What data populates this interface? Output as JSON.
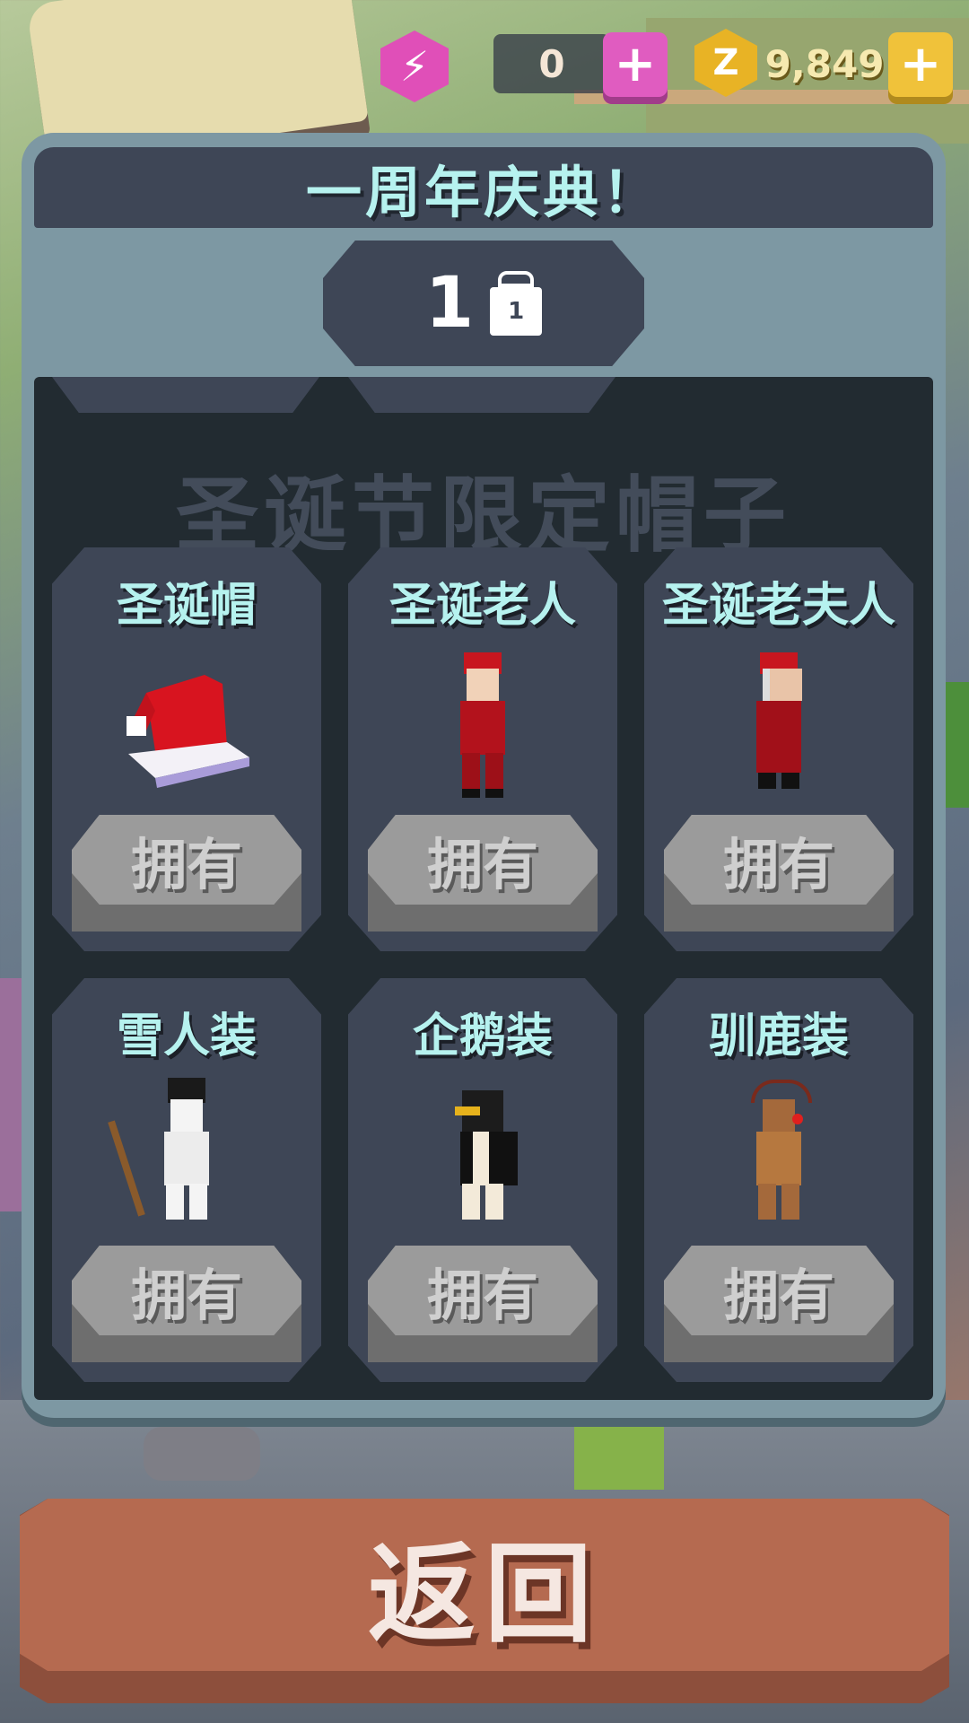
{
  "topbar": {
    "gem_icon": "lightning-gem-icon",
    "gem_count": "0",
    "gem_plus": "+",
    "coin_icon": "z-coin-icon",
    "coin_symbol": "Z",
    "coin_count": "9,849",
    "coin_plus": "+"
  },
  "panel": {
    "title": "一周年庆典！",
    "gift_count": "1",
    "gift_box_number": "1",
    "section_title": "圣诞节限定帽子"
  },
  "items": [
    {
      "name": "圣诞帽",
      "button": "拥有",
      "art": "santa-hat-icon"
    },
    {
      "name": "圣诞老人",
      "button": "拥有",
      "art": "santa-costume-icon"
    },
    {
      "name": "圣诞老夫人",
      "button": "拥有",
      "art": "mrs-claus-costume-icon"
    },
    {
      "name": "雪人装",
      "button": "拥有",
      "art": "snowman-costume-icon"
    },
    {
      "name": "企鹅装",
      "button": "拥有",
      "art": "penguin-costume-icon"
    },
    {
      "name": "驯鹿装",
      "button": "拥有",
      "art": "reindeer-costume-icon"
    }
  ],
  "footer": {
    "back_label": "返回"
  },
  "colors": {
    "title_text": "#b6f2ef",
    "panel": "#7d98a3",
    "card": "#3e4656",
    "owned_button": "#9b9b9b",
    "back_button": "#b56a50",
    "gem": "#e04fb8",
    "coin": "#e8b325"
  }
}
